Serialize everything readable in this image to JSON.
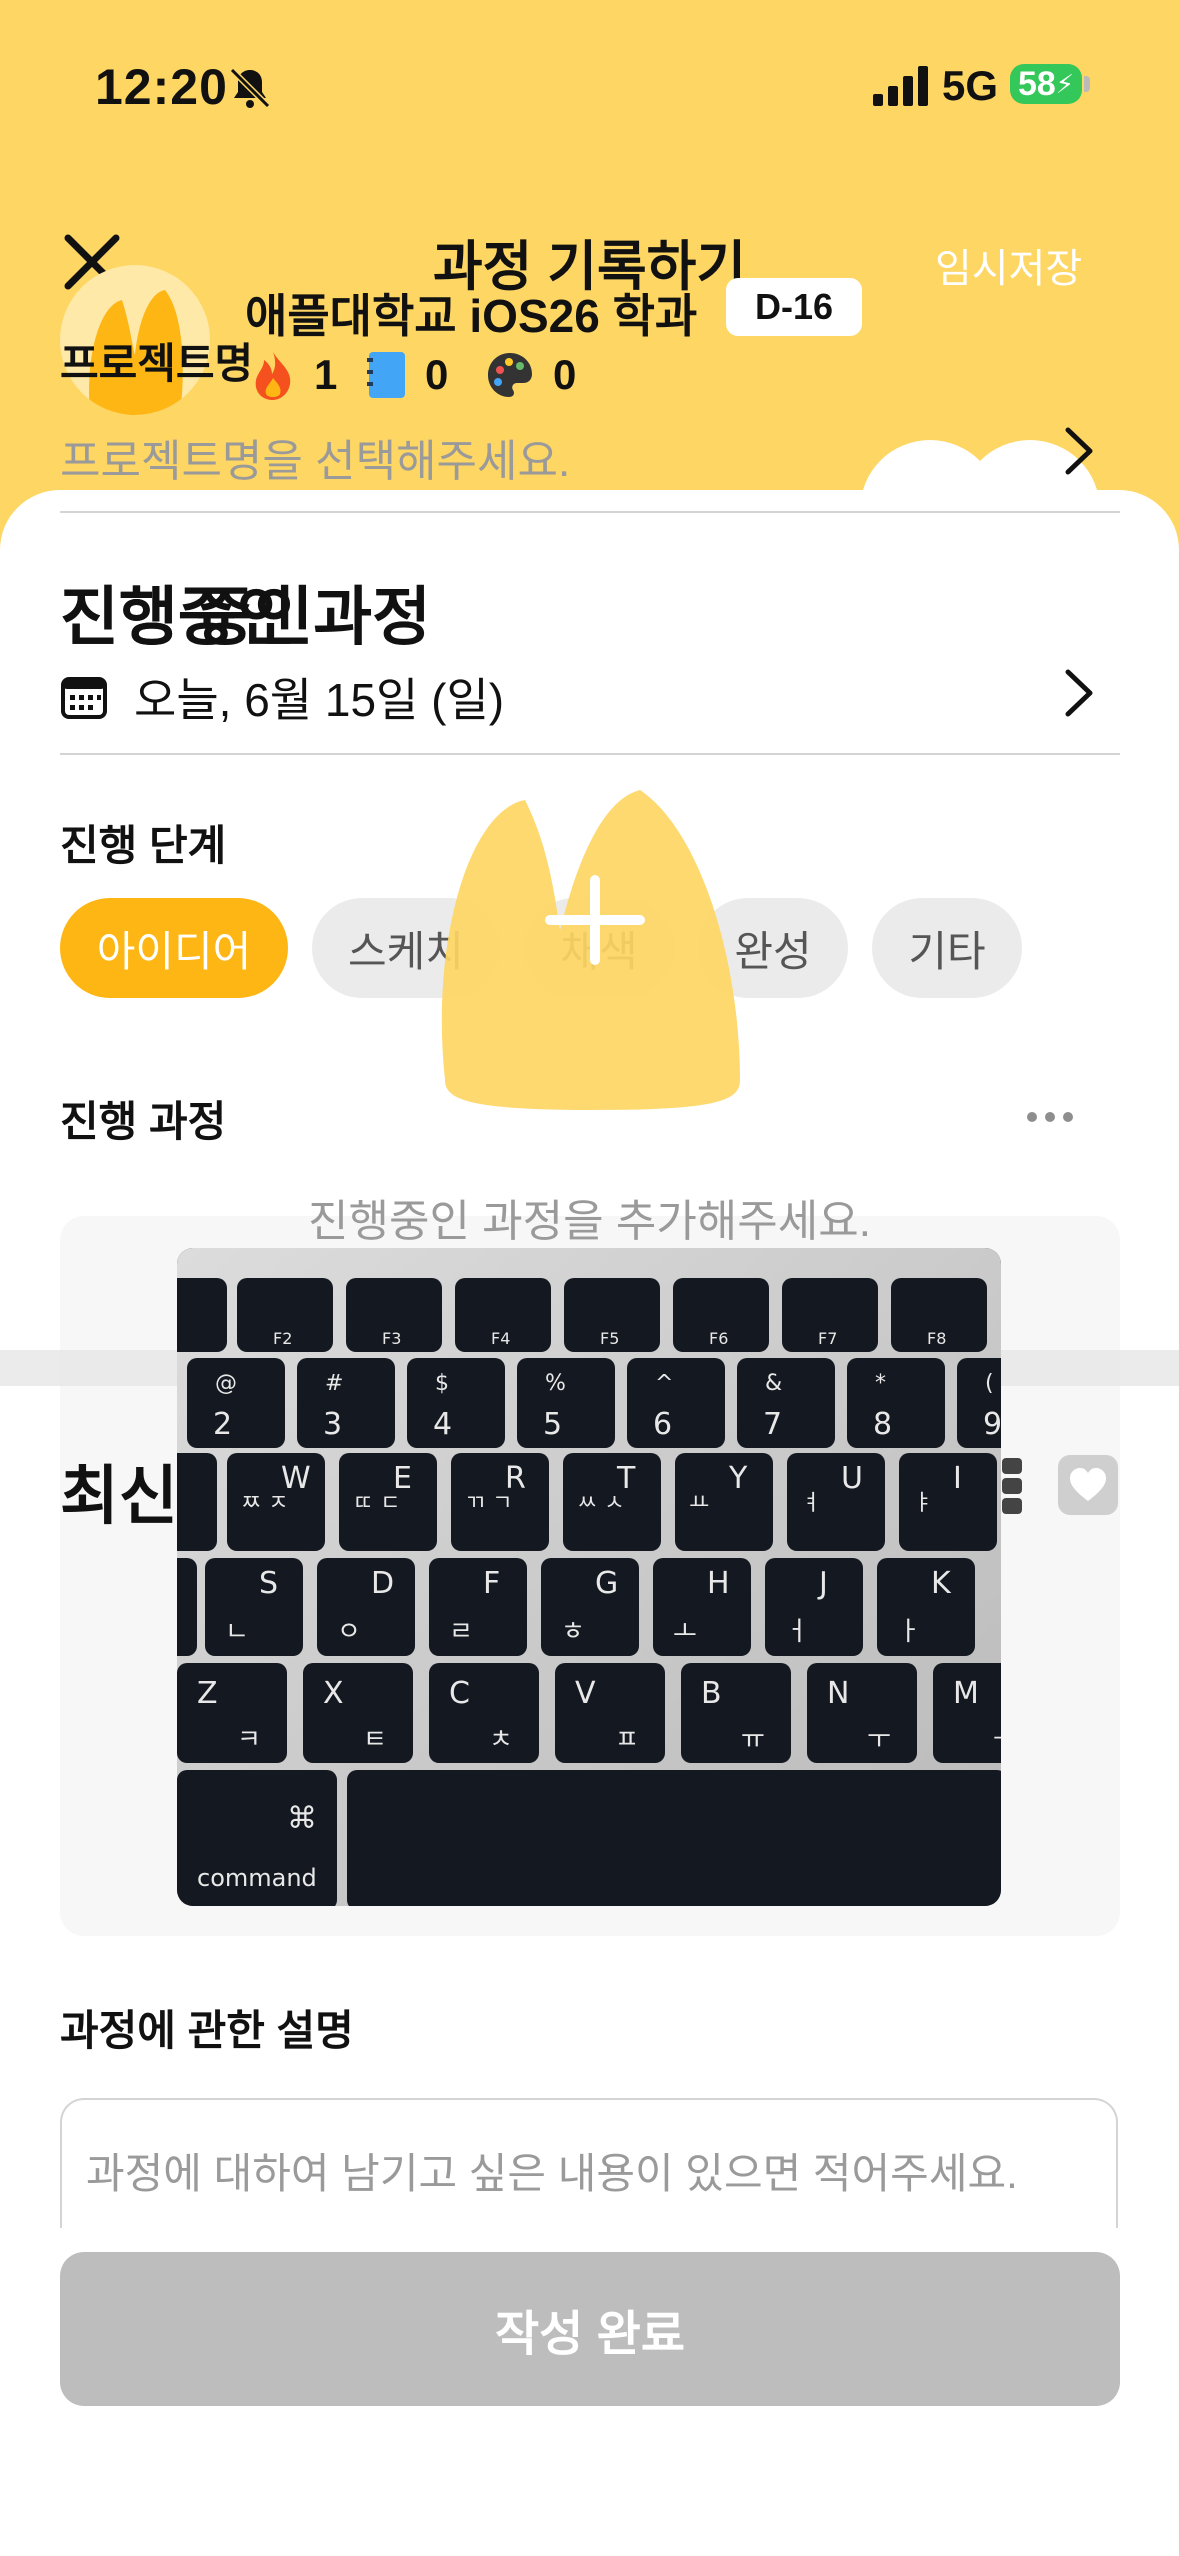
{
  "status_bar": {
    "time": "12:20",
    "network": "5G",
    "battery": "58"
  },
  "header": {
    "title": "과정 기록하기",
    "save_label": "임시저장",
    "school": "애플대학교 iOS26 학과",
    "dday": "D-16",
    "stats": [
      {
        "icon": "fire-icon",
        "value": "1"
      },
      {
        "icon": "notebook-icon",
        "value": "0"
      },
      {
        "icon": "palette-icon",
        "value": "0"
      }
    ]
  },
  "project": {
    "label": "프로젝트명",
    "placeholder": "프로젝트명을 선택해주세요."
  },
  "section": {
    "title": "진행중인 과정",
    "title_overlay": "진행 중인",
    "date": "오늘, 6월 15일 (일)"
  },
  "steps": {
    "label": "진행 단계",
    "items": [
      "아이디어",
      "스케치",
      "채색",
      "완성",
      "기타"
    ],
    "active_index": 0
  },
  "process": {
    "label": "진행 과정",
    "hint": "진행중인 과정을 추가해주세요."
  },
  "recent": {
    "title": "최신"
  },
  "description": {
    "label": "과정에 관한 설명",
    "placeholder": "과정에 대하여 남기고 싶은 내용이 있으면 적어주세요."
  },
  "submit_label": "작성 완료",
  "keyboard": {
    "row1": [
      "F2",
      "F3",
      "F4",
      "F5",
      "F6",
      "F7",
      "F8"
    ],
    "row2": [
      [
        "@",
        "2"
      ],
      [
        "#",
        "3"
      ],
      [
        "$",
        "4"
      ],
      [
        "%",
        "5"
      ],
      [
        "^",
        "6"
      ],
      [
        "&",
        "7"
      ],
      [
        "*",
        "8"
      ],
      [
        "(",
        "9"
      ]
    ],
    "row3": [
      [
        "W",
        "ㅉ ㅈ"
      ],
      [
        "E",
        "ㄸ ㄷ"
      ],
      [
        "R",
        "ㄲ ㄱ"
      ],
      [
        "T",
        "ㅆ ㅅ"
      ],
      [
        "Y",
        "ㅛ"
      ],
      [
        "U",
        "ㅕ"
      ],
      [
        "I",
        "ㅑ"
      ]
    ],
    "row4": [
      [
        "S",
        "ㄴ"
      ],
      [
        "D",
        "ㅇ"
      ],
      [
        "F",
        "ㄹ"
      ],
      [
        "G",
        "ㅎ"
      ],
      [
        "H",
        "ㅗ"
      ],
      [
        "J",
        "ㅓ"
      ],
      [
        "K",
        "ㅏ"
      ]
    ],
    "row5": [
      [
        "Z",
        "ㅋ"
      ],
      [
        "X",
        "ㅌ"
      ],
      [
        "C",
        "ㅊ"
      ],
      [
        "V",
        "ㅍ"
      ],
      [
        "B",
        "ㅠ"
      ],
      [
        "N",
        "ㅜ"
      ],
      [
        "M",
        "ㅡ"
      ]
    ],
    "command": "command",
    "command_symbol": "⌘"
  },
  "colors": {
    "header_yellow": "#FDD663",
    "chip_active": "#FDB614",
    "submit_disabled": "#BDBDBD"
  }
}
